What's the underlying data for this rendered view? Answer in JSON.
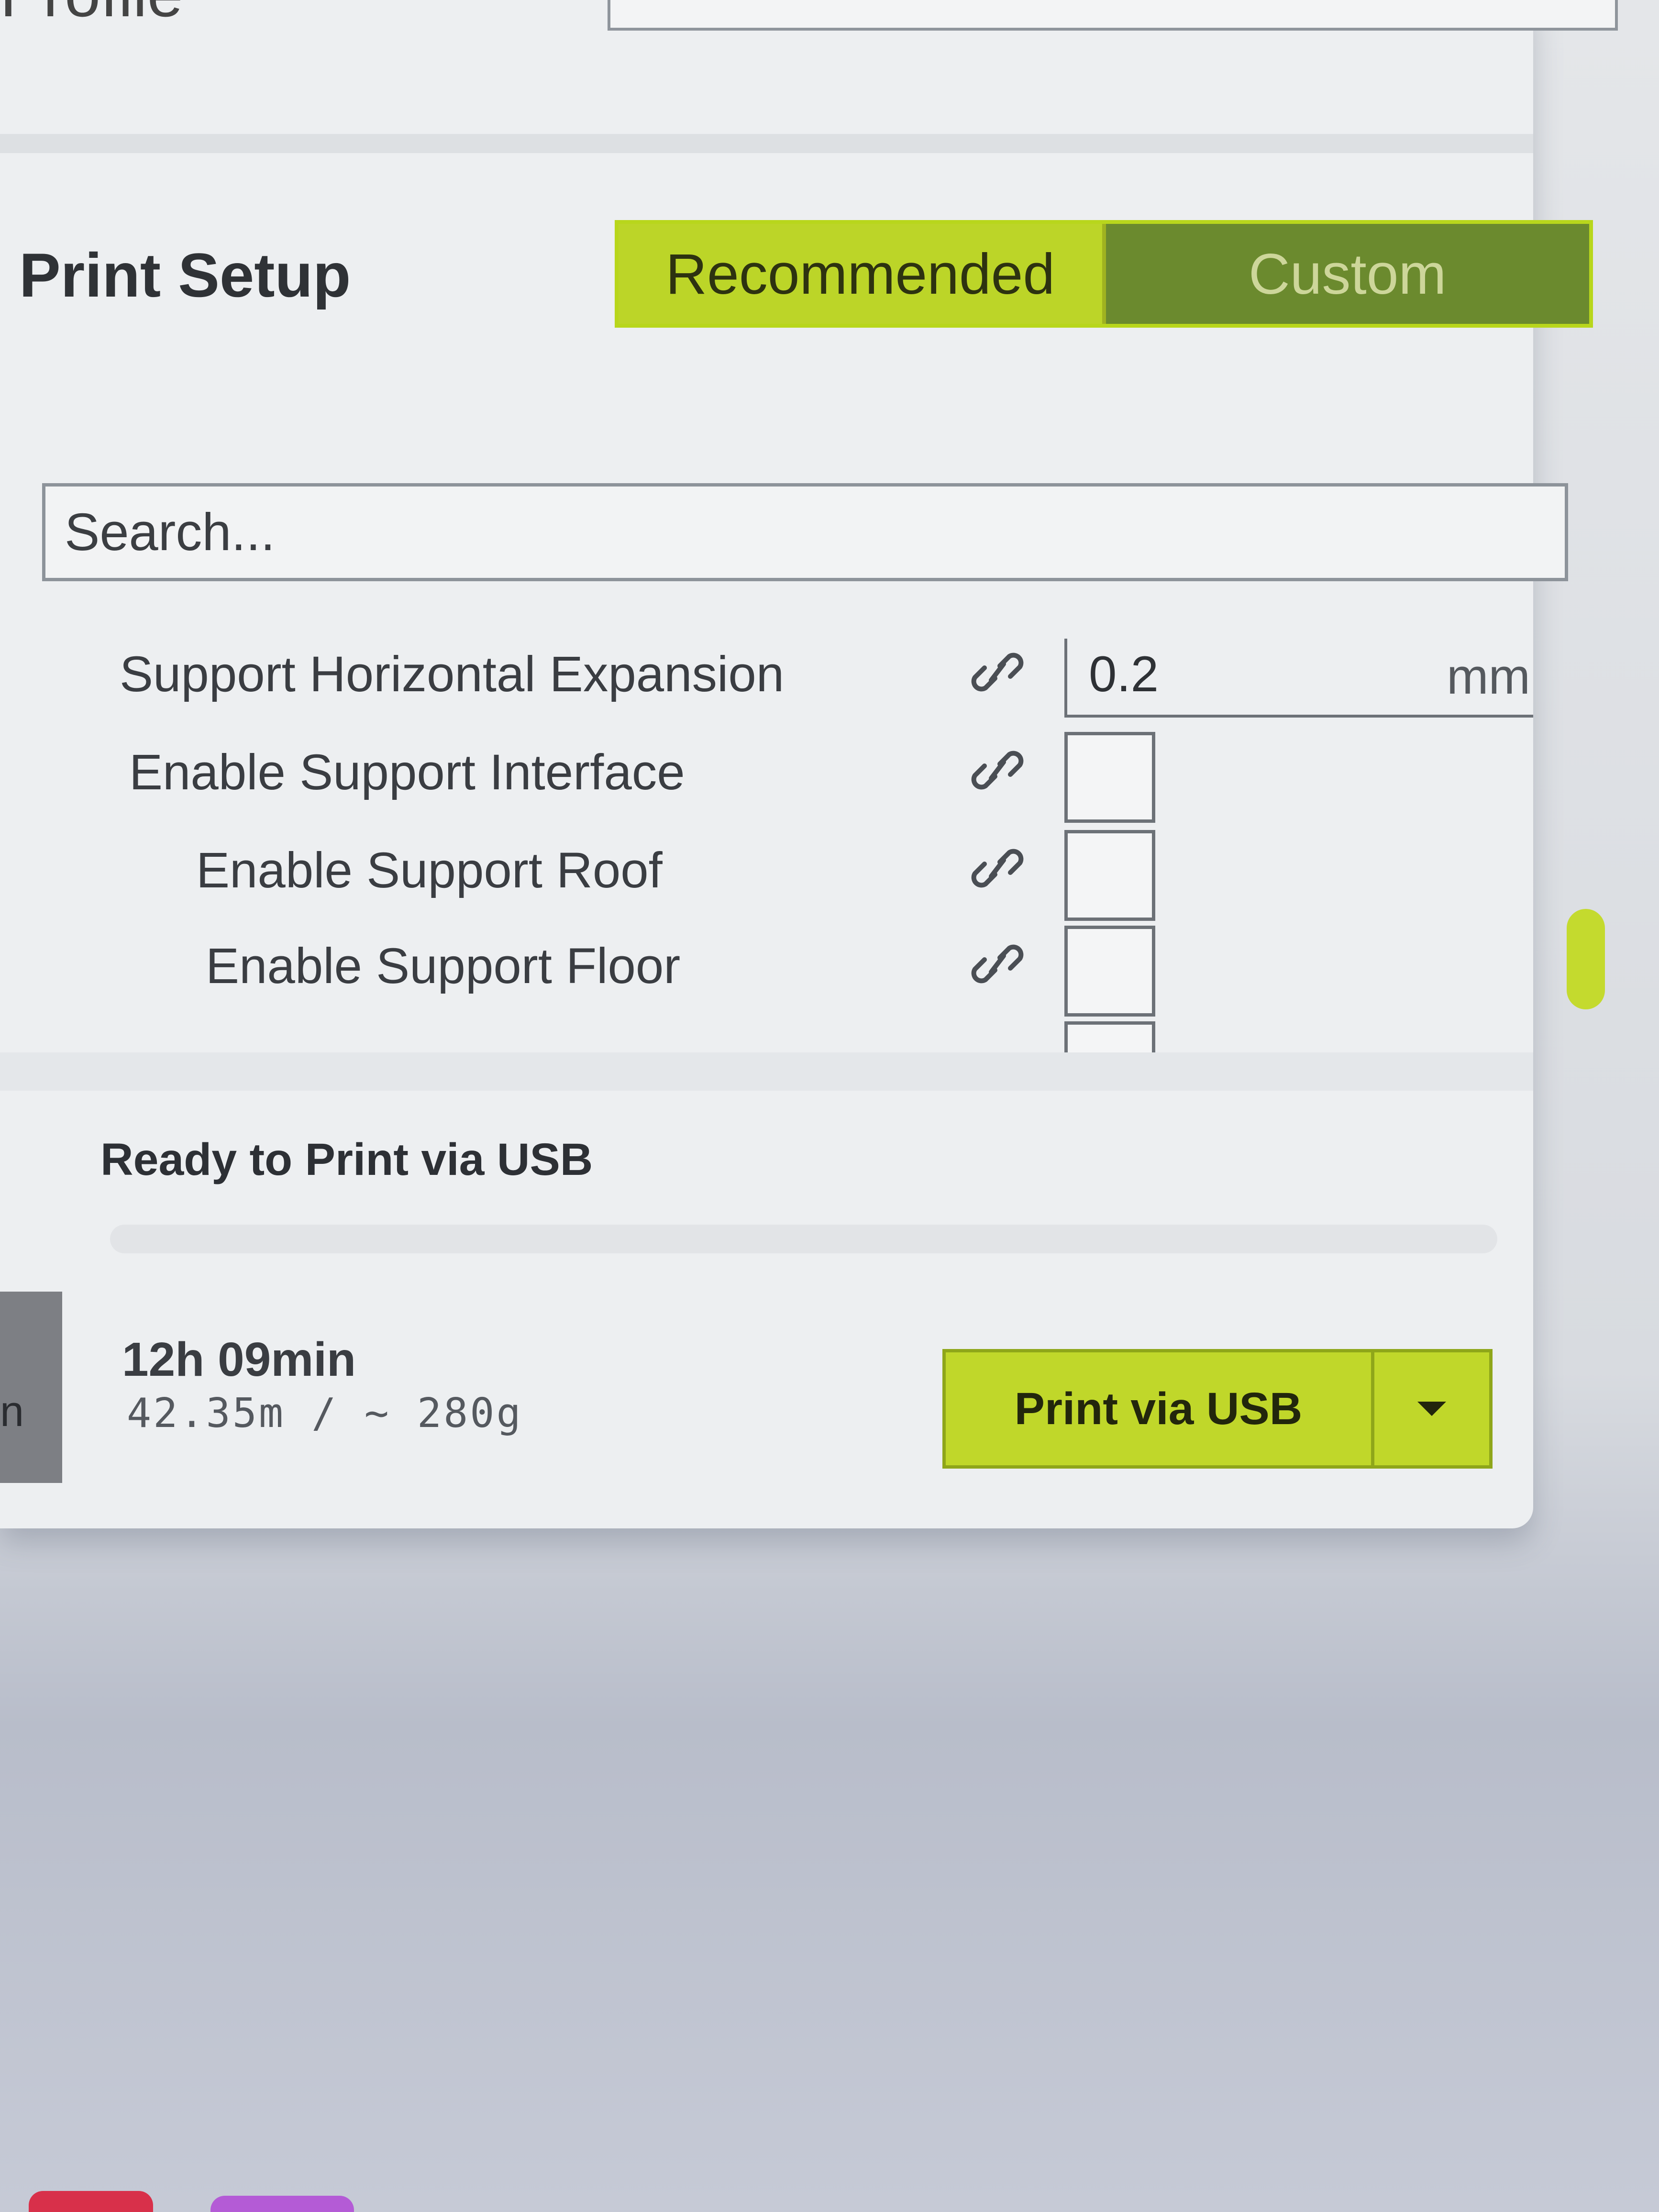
{
  "header": {
    "profile_label": "Profile"
  },
  "print_setup": {
    "title": "Print Setup",
    "modes": [
      {
        "label": "Recommended",
        "active": false
      },
      {
        "label": "Custom",
        "active": true
      }
    ],
    "search": {
      "placeholder": "Search...",
      "value": ""
    },
    "settings": [
      {
        "label": "Support Horizontal Expansion",
        "value": "0.2",
        "unit": "mm"
      },
      {
        "label": "Enable Support Interface",
        "checked": false
      },
      {
        "label": "Enable Support Roof",
        "checked": false
      },
      {
        "label": "Enable Support Floor",
        "checked": false
      }
    ]
  },
  "print_status": {
    "status": "Ready to Print via USB",
    "progress": 0,
    "time": "12h 09min",
    "material": "42.35m / ~ 280g",
    "print_button_label": "Print via USB"
  },
  "colors": {
    "accent": "#bcd528",
    "accent_dark": "#6b8a2e",
    "panel": "#edeff1"
  },
  "icons": {
    "link": "link-icon",
    "dropdown": "caret-down-icon"
  }
}
